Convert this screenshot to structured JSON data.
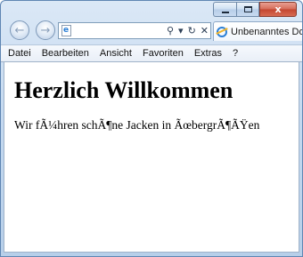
{
  "window": {
    "tab_title": "Unbenanntes Dok",
    "address_icon": "ie-page-icon"
  },
  "caption": {
    "close_label": "x"
  },
  "nav": {
    "back_icon": "back-arrow-icon",
    "forward_icon": "forward-arrow-icon",
    "search_glyph": "⚲",
    "dropdown_glyph": "▾",
    "refresh_glyph": "↻",
    "stop_glyph": "✕"
  },
  "menu": {
    "items": [
      "Datei",
      "Bearbeiten",
      "Ansicht",
      "Favoriten",
      "Extras",
      "?"
    ]
  },
  "page": {
    "heading": "Herzlich Willkommen",
    "paragraph": "Wir fÃ¼hren schÃ¶ne Jacken in ÃœbergrÃ¶ÃŸen"
  }
}
